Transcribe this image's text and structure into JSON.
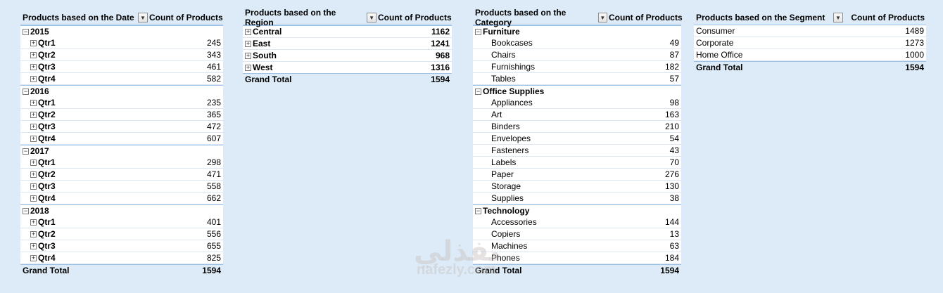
{
  "date_pivot": {
    "row_header": "Products based on the Date",
    "value_header": "Count of Products",
    "years": [
      {
        "label": "2015",
        "quarters": [
          {
            "label": "Qtr1",
            "value": "245"
          },
          {
            "label": "Qtr2",
            "value": "343"
          },
          {
            "label": "Qtr3",
            "value": "461"
          },
          {
            "label": "Qtr4",
            "value": "582"
          }
        ]
      },
      {
        "label": "2016",
        "quarters": [
          {
            "label": "Qtr1",
            "value": "235"
          },
          {
            "label": "Qtr2",
            "value": "365"
          },
          {
            "label": "Qtr3",
            "value": "472"
          },
          {
            "label": "Qtr4",
            "value": "607"
          }
        ]
      },
      {
        "label": "2017",
        "quarters": [
          {
            "label": "Qtr1",
            "value": "298"
          },
          {
            "label": "Qtr2",
            "value": "471"
          },
          {
            "label": "Qtr3",
            "value": "558"
          },
          {
            "label": "Qtr4",
            "value": "662"
          }
        ]
      },
      {
        "label": "2018",
        "quarters": [
          {
            "label": "Qtr1",
            "value": "401"
          },
          {
            "label": "Qtr2",
            "value": "556"
          },
          {
            "label": "Qtr3",
            "value": "655"
          },
          {
            "label": "Qtr4",
            "value": "825"
          }
        ]
      }
    ],
    "total_label": "Grand Total",
    "total_value": "1594"
  },
  "region_pivot": {
    "row_header": "Products based on the Region",
    "value_header": "Count of Products",
    "rows": [
      {
        "label": "Central",
        "value": "1162"
      },
      {
        "label": "East",
        "value": "1241"
      },
      {
        "label": "South",
        "value": "968"
      },
      {
        "label": "West",
        "value": "1316"
      }
    ],
    "total_label": "Grand Total",
    "total_value": "1594"
  },
  "category_pivot": {
    "row_header": "Products based on the Category",
    "value_header": "Count of Products",
    "groups": [
      {
        "label": "Furniture",
        "items": [
          {
            "label": "Bookcases",
            "value": "49"
          },
          {
            "label": "Chairs",
            "value": "87"
          },
          {
            "label": "Furnishings",
            "value": "182"
          },
          {
            "label": "Tables",
            "value": "57"
          }
        ]
      },
      {
        "label": "Office Supplies",
        "items": [
          {
            "label": "Appliances",
            "value": "98"
          },
          {
            "label": "Art",
            "value": "163"
          },
          {
            "label": "Binders",
            "value": "210"
          },
          {
            "label": "Envelopes",
            "value": "54"
          },
          {
            "label": "Fasteners",
            "value": "43"
          },
          {
            "label": "Labels",
            "value": "70"
          },
          {
            "label": "Paper",
            "value": "276"
          },
          {
            "label": "Storage",
            "value": "130"
          },
          {
            "label": "Supplies",
            "value": "38"
          }
        ]
      },
      {
        "label": "Technology",
        "items": [
          {
            "label": "Accessories",
            "value": "144"
          },
          {
            "label": "Copiers",
            "value": "13"
          },
          {
            "label": "Machines",
            "value": "63"
          },
          {
            "label": "Phones",
            "value": "184"
          }
        ]
      }
    ],
    "total_label": "Grand Total",
    "total_value": "1594"
  },
  "segment_pivot": {
    "row_header": "Products based on the Segment",
    "value_header": "Count of Products",
    "rows": [
      {
        "label": "Consumer",
        "value": "1489"
      },
      {
        "label": "Corporate",
        "value": "1273"
      },
      {
        "label": "Home Office",
        "value": "1000"
      }
    ],
    "total_label": "Grand Total",
    "total_value": "1594"
  },
  "watermark": {
    "arabic": "نفذلي",
    "latin": "nafezly.com"
  },
  "icons": {
    "expand": "plus-box-icon",
    "collapse": "minus-box-icon",
    "filter": "dropdown-arrow-icon"
  },
  "colors": {
    "background": "#dcebf7",
    "row_fill": "#ffffff",
    "border": "#9bc2e6"
  }
}
